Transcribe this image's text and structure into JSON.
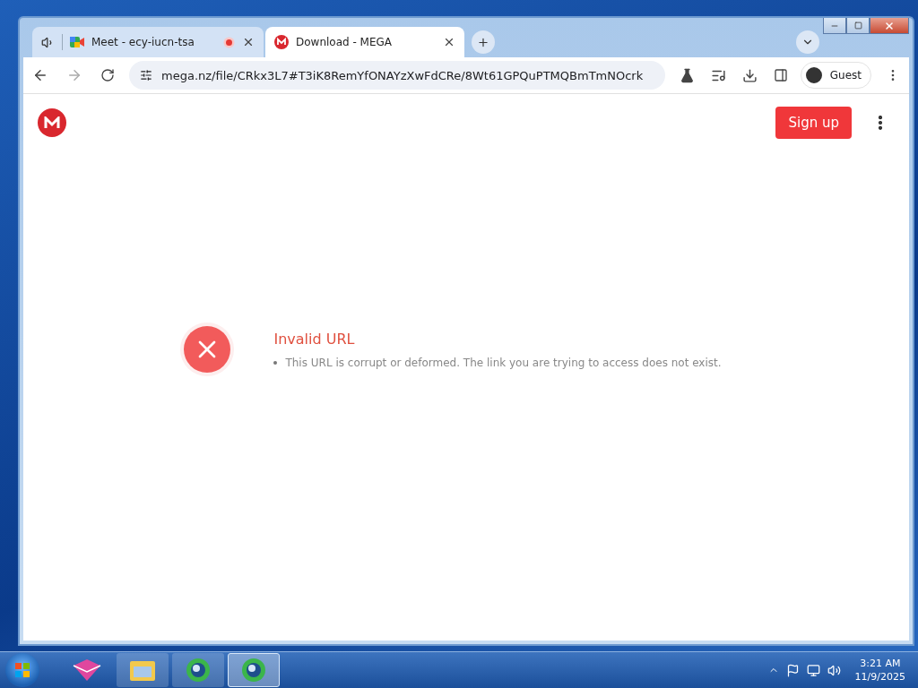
{
  "tabs": [
    {
      "kind": "meet",
      "title": "Meet - ecy-iucn-tsa",
      "audio": true,
      "recording": true,
      "selected": false
    },
    {
      "kind": "mega",
      "title": "Download - MEGA",
      "audio": false,
      "recording": false,
      "selected": true
    }
  ],
  "toolbar": {
    "url": "mega.nz/file/CRkx3L7#T3iK8RemYfONAYzXwFdCRe/8Wt61GPQuPTMQBmTmNOcrk",
    "profile": "Guest"
  },
  "page": {
    "signup": "Sign up",
    "error": {
      "title": "Invalid URL",
      "items": [
        "This URL is corrupt or deformed. The link you are trying to access does not exist."
      ]
    }
  },
  "taskbar": {
    "apps": [
      {
        "kind": "app",
        "selected": false
      },
      {
        "kind": "folder",
        "selected": false
      },
      {
        "kind": "browser",
        "selected": false
      },
      {
        "kind": "browser",
        "selected": true
      }
    ],
    "time": "3:21 AM",
    "date": "11/9/2025"
  }
}
